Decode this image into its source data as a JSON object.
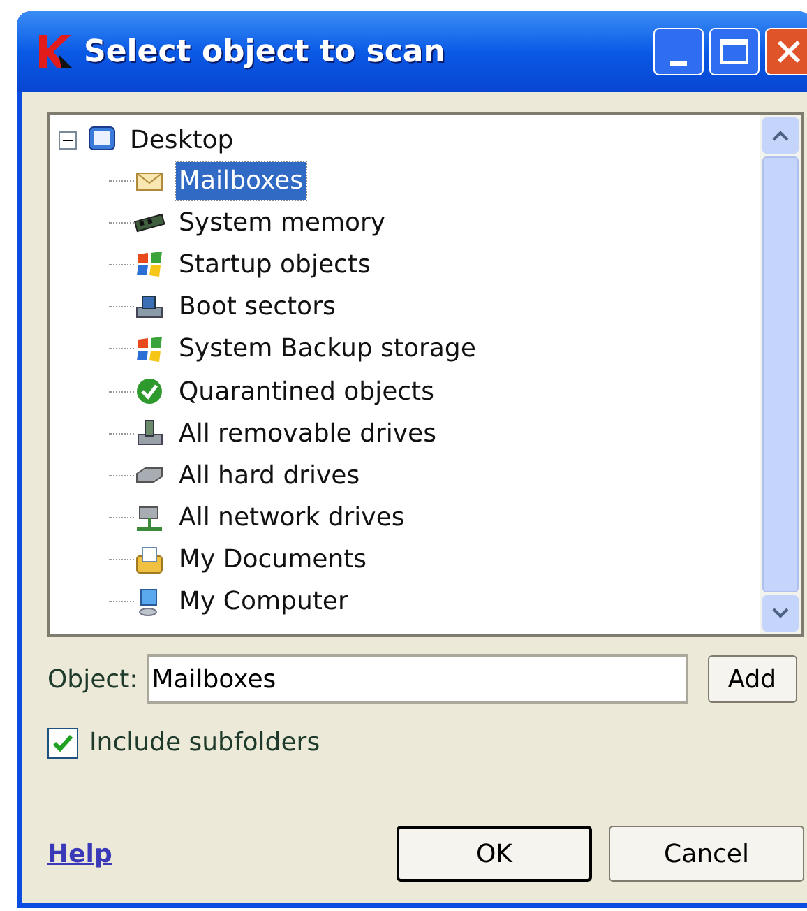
{
  "window": {
    "title": "Select object to scan"
  },
  "tree": {
    "label": "Desktop",
    "expanded": true,
    "children": [
      {
        "label": "Mailboxes",
        "kind": "mail",
        "selected": true
      },
      {
        "label": "System memory",
        "kind": "memory",
        "selected": false
      },
      {
        "label": "Startup objects",
        "kind": "windows",
        "selected": false
      },
      {
        "label": "Boot sectors",
        "kind": "boot",
        "selected": false
      },
      {
        "label": "System Backup storage",
        "kind": "windows",
        "selected": false
      },
      {
        "label": "Quarantined objects",
        "kind": "check",
        "selected": false
      },
      {
        "label": "All removable drives",
        "kind": "removable",
        "selected": false
      },
      {
        "label": "All hard drives",
        "kind": "harddrive",
        "selected": false
      },
      {
        "label": "All network drives",
        "kind": "network",
        "selected": false
      },
      {
        "label": "My Documents",
        "kind": "documents",
        "selected": false
      },
      {
        "label": "My Computer",
        "kind": "computer",
        "selected": false
      }
    ]
  },
  "object_field": {
    "label": "Object:",
    "value": "Mailboxes"
  },
  "add_button": "Add",
  "include_subfolders": {
    "label": "Include subfolders",
    "checked": true
  },
  "help_link": "Help",
  "buttons": [
    "OK",
    "Cancel"
  ]
}
